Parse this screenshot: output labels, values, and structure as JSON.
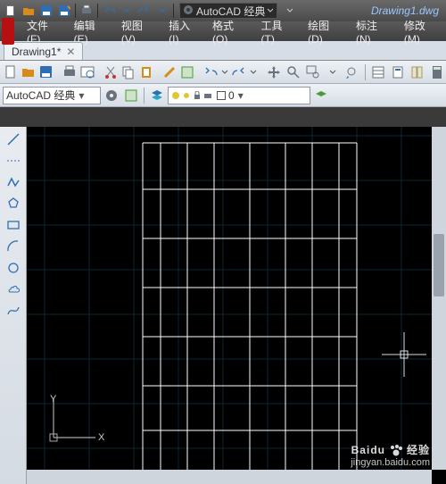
{
  "qat": {
    "workspace_label": "AutoCAD 经典",
    "doc_title": "Drawing1.dwg"
  },
  "menu": {
    "items": [
      "文件(F)",
      "编辑(E)",
      "视图(V)",
      "插入(I)",
      "格式(O)",
      "工具(T)",
      "绘图(D)",
      "标注(N)",
      "修改(M)"
    ]
  },
  "doc_tab": {
    "label": "Drawing1*"
  },
  "wsrow": {
    "workspace": "AutoCAD 经典",
    "layer_value": "0",
    "layer_color": "#ffffff"
  },
  "watermark": {
    "brand_cn": "Baidu",
    "brand_sub": "经验",
    "url": "jingyan.baidu.com"
  },
  "ucs": {
    "x": "X",
    "y": "Y"
  }
}
